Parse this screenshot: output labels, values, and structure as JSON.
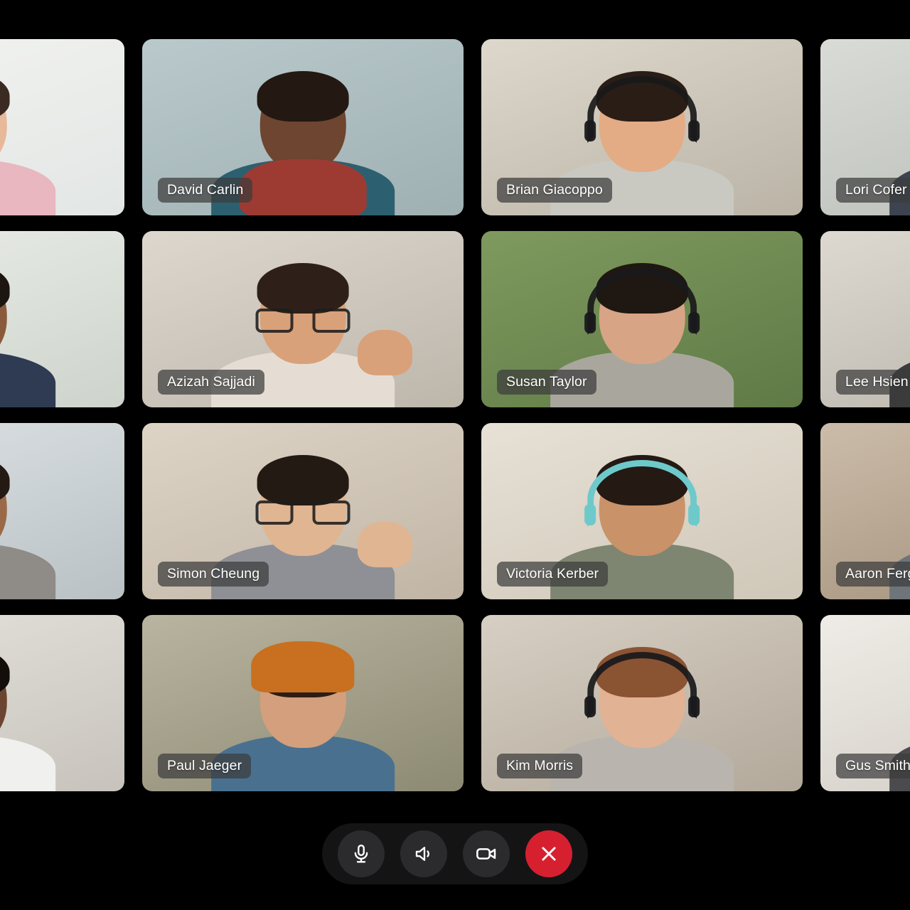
{
  "app": {
    "name": "video-call-grid",
    "background_color": "#000000"
  },
  "grid": {
    "columns": 4,
    "rows": 4,
    "participants": [
      {
        "name": "",
        "label_visible": false,
        "clipped": "left",
        "skin": "#e8b89a",
        "hair": "#3a2a22",
        "shirt": "#e9b7bf",
        "bg_top": "#f4f4f2",
        "bg_bottom": "#e2e6e4",
        "accessory": "none",
        "hand": "none"
      },
      {
        "name": "David Carlin",
        "label_visible": true,
        "clipped": "none",
        "skin": "#6d4530",
        "hair": "#231812",
        "shirt": "#2c6070",
        "bg_top": "#b9c9cc",
        "bg_bottom": "#9fb0b3",
        "accessory": "scarf",
        "hand": "none"
      },
      {
        "name": "Brian Giacoppo",
        "label_visible": true,
        "clipped": "none",
        "skin": "#e3ac85",
        "hair": "#2a1d16",
        "shirt": "#c9c9c2",
        "bg_top": "#ded8cc",
        "bg_bottom": "#bab3a6",
        "accessory": "headphones",
        "hand": "none"
      },
      {
        "name": "Lori Cofer",
        "label_visible": true,
        "clipped": "right",
        "skin": "#d8a585",
        "hair": "#3a2b20",
        "shirt": "#3d4450",
        "bg_top": "#d9dcd6",
        "bg_bottom": "#b8bcb6",
        "accessory": "none",
        "hand": "none"
      },
      {
        "name": "",
        "label_visible": false,
        "clipped": "left",
        "skin": "#8a5a3c",
        "hair": "#1d1510",
        "shirt": "#2e3b52",
        "bg_top": "#eceee9",
        "bg_bottom": "#cdd4cc",
        "accessory": "none",
        "hand": "none"
      },
      {
        "name": "Azizah Sajjadi",
        "label_visible": true,
        "clipped": "none",
        "skin": "#d9a17a",
        "hair": "#2e2018",
        "shirt": "#e5ddd4",
        "bg_top": "#ddd7ce",
        "bg_bottom": "#bdb6ab",
        "accessory": "glasses",
        "hand": "right"
      },
      {
        "name": "Susan Taylor",
        "label_visible": true,
        "clipped": "none",
        "skin": "#d8a486",
        "hair": "#1e1712",
        "shirt": "#a9a79d",
        "bg_top": "#7e9a5e",
        "bg_bottom": "#5f7a46",
        "accessory": "headphones",
        "hand": "none"
      },
      {
        "name": "Lee Hsien Wei",
        "label_visible": true,
        "clipped": "right",
        "skin": "#caa083",
        "hair": "#241b14",
        "shirt": "#3b3b3b",
        "bg_top": "#ddd9d1",
        "bg_bottom": "#b7b2a8",
        "accessory": "none",
        "hand": "none"
      },
      {
        "name": "",
        "label_visible": false,
        "clipped": "left",
        "skin": "#9a6a48",
        "hair": "#251a13",
        "shirt": "#8f8b86",
        "bg_top": "#dfe4e6",
        "bg_bottom": "#b9c1c4",
        "accessory": "none",
        "hand": "none"
      },
      {
        "name": "Simon Cheung",
        "label_visible": true,
        "clipped": "none",
        "skin": "#e0b592",
        "hair": "#241a14",
        "shirt": "#8e9095",
        "bg_top": "#ded4c6",
        "bg_bottom": "#c0b5a5",
        "accessory": "glasses",
        "hand": "right"
      },
      {
        "name": "Victoria Kerber",
        "label_visible": true,
        "clipped": "none",
        "skin": "#c99268",
        "hair": "#241913",
        "shirt": "#7e8571",
        "bg_top": "#e7e1d6",
        "bg_bottom": "#cfc7b8",
        "accessory": "headphones-teal",
        "hand": "none"
      },
      {
        "name": "Aaron Ferguson",
        "label_visible": true,
        "clipped": "right",
        "skin": "#c89a77",
        "hair": "#2b2119",
        "shirt": "#6e747a",
        "bg_top": "#cbbca9",
        "bg_bottom": "#a08d77",
        "accessory": "none",
        "hand": "none"
      },
      {
        "name": "",
        "label_visible": false,
        "clipped": "left",
        "skin": "#6b452f",
        "hair": "#140e0a",
        "shirt": "#f0f0ee",
        "bg_top": "#e6e3de",
        "bg_bottom": "#c7c3bc",
        "accessory": "none",
        "hand": "none"
      },
      {
        "name": "Paul Jaeger",
        "label_visible": true,
        "clipped": "none",
        "skin": "#d49f7c",
        "hair": "#2b1d14",
        "shirt": "#49718f",
        "bg_top": "#b9b49f",
        "bg_bottom": "#8d8a74",
        "accessory": "beanie",
        "hand": "none"
      },
      {
        "name": "Kim Morris",
        "label_visible": true,
        "clipped": "none",
        "skin": "#e2b294",
        "hair": "#8a5433",
        "shirt": "#b9b4ad",
        "bg_top": "#d7cfc3",
        "bg_bottom": "#b2a99b",
        "accessory": "headphones",
        "hand": "none"
      },
      {
        "name": "Gus Smith",
        "label_visible": true,
        "clipped": "right",
        "skin": "#d7a98b",
        "hair": "#3a2a1e",
        "shirt": "#4b4b4f",
        "bg_top": "#efece7",
        "bg_bottom": "#cfcac2",
        "accessory": "none",
        "hand": "none"
      }
    ]
  },
  "controls": {
    "items": [
      {
        "id": "microphone",
        "icon": "microphone-icon",
        "label": "Microphone",
        "style": "default",
        "color": "#2b2b2d"
      },
      {
        "id": "speaker",
        "icon": "speaker-icon",
        "label": "Speaker",
        "style": "default",
        "color": "#2b2b2d"
      },
      {
        "id": "camera",
        "icon": "camera-icon",
        "label": "Camera",
        "style": "default",
        "color": "#2b2b2d"
      },
      {
        "id": "end-call",
        "icon": "close-icon",
        "label": "End call",
        "style": "danger",
        "color": "#d62030"
      }
    ]
  }
}
